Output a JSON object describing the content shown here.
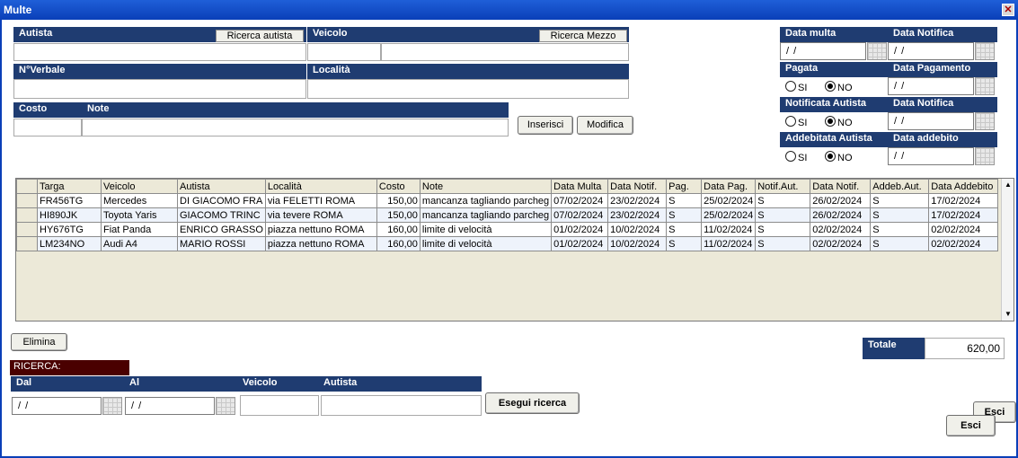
{
  "window": {
    "title": "Multe",
    "close_glyph": "✕"
  },
  "form": {
    "autista_label": "Autista",
    "ricerca_autista_btn": "Ricerca autista",
    "veicolo_label": "Veicolo",
    "ricerca_mezzo_btn": "Ricerca Mezzo",
    "verbale_label": "N°Verbale",
    "localita_label": "Località",
    "costo_label": "Costo",
    "note_label": "Note",
    "inserisci_btn": "Inserisci",
    "modifica_btn": "Modifica"
  },
  "right_panel": {
    "data_multa_label": "Data multa",
    "data_notifica_label": "Data Notifica",
    "pagata_label": "Pagata",
    "data_pagamento_label": "Data Pagamento",
    "notificata_autista_label": "Notificata Autista",
    "data_notifica2_label": "Data Notifica",
    "addebitata_autista_label": "Addebitata Autista",
    "data_addebito_label": "Data addebito",
    "empty_date": "/ /",
    "si": "SI",
    "no": "NO"
  },
  "table": {
    "columns": [
      "Targa",
      "Veicolo",
      "Autista",
      "Località",
      "Costo",
      "Note",
      "Data Multa",
      "Data Notif.",
      "Pag.",
      "Data Pag.",
      "Notif.Aut.",
      "Data Notif.",
      "Addeb.Aut.",
      "Data Addebito"
    ],
    "rows": [
      [
        "FR456TG",
        "Mercedes",
        "DI GIACOMO FRA",
        "via FELETTI  ROMA",
        "150,00",
        "mancanza tagliando parcheg",
        "07/02/2024",
        "23/02/2024",
        "S",
        "25/02/2024",
        "S",
        "26/02/2024",
        "S",
        "17/02/2024"
      ],
      [
        "HI890JK",
        "Toyota Yaris",
        "GIACOMO TRINC",
        "via tevere ROMA",
        "150,00",
        "mancanza tagliando parcheg",
        "07/02/2024",
        "23/02/2024",
        "S",
        "25/02/2024",
        "S",
        "26/02/2024",
        "S",
        "17/02/2024"
      ],
      [
        "HY676TG",
        "Fiat Panda",
        "ENRICO GRASSO",
        "piazza nettuno  ROMA",
        "160,00",
        "limite di velocità",
        "01/02/2024",
        "10/02/2024",
        "S",
        "11/02/2024",
        "S",
        "02/02/2024",
        "S",
        "02/02/2024"
      ],
      [
        "LM234NO",
        "Audi A4",
        "MARIO ROSSI",
        "piazza nettuno ROMA",
        "160,00",
        "limite di velocità",
        "01/02/2024",
        "10/02/2024",
        "S",
        "11/02/2024",
        "S",
        "02/02/2024",
        "S",
        "02/02/2024"
      ]
    ]
  },
  "elimina_btn": "Elimina",
  "totale": {
    "label": "Totale",
    "value": "620,00"
  },
  "ricerca": {
    "title": "RICERCA:",
    "dal_label": "Dal",
    "al_label": "Al",
    "veicolo_label": "Veicolo",
    "autista_label": "Autista",
    "dal_value": "/ /",
    "al_value": "/ /",
    "esegui_btn": "Esegui ricerca"
  },
  "esci_btn": "Esci",
  "esci_btn2": "Esci"
}
